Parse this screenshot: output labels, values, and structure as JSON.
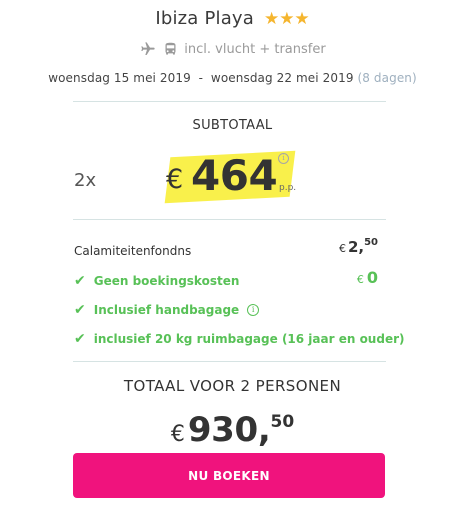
{
  "hotel": {
    "name": "Ibiza Playa",
    "stars": "★★★",
    "star_count": 3
  },
  "includes": {
    "text": "incl. vlucht + transfer",
    "icons": [
      "plane-icon",
      "bus-icon"
    ]
  },
  "dates": {
    "range": "woensdag 15 mei 2019  -  woensdag 22 mei 2019",
    "duration": "(8 dagen)"
  },
  "subtotal": {
    "label": "SUBTOTAAL",
    "quantity": "2x",
    "currency": "€",
    "amount": "464",
    "per_person": "p.p.",
    "info_symbol": "i"
  },
  "fees": {
    "fund_label": "Calamiteitenfondns",
    "fund_currency": "€",
    "fund_whole": "2,",
    "fund_cents": "50"
  },
  "features": [
    {
      "label": "Geen boekingskosten",
      "icon": "check-icon",
      "amount_currency": "€",
      "amount": "0"
    },
    {
      "label": "Inclusief handbagage",
      "icon": "check-icon",
      "info_symbol": "i"
    },
    {
      "label": "inclusief 20 kg ruimbagage (16 jaar en ouder)",
      "icon": "check-icon"
    }
  ],
  "total": {
    "label": "TOTAAL VOOR 2 PERSONEN",
    "currency": "€",
    "amount_whole": "930,",
    "amount_cents": "50"
  },
  "cta": {
    "label": "NU BOEKEN"
  },
  "colors": {
    "accent": "#f0137d",
    "success": "#58c157",
    "star": "#f5b52e",
    "highlight": "#f8ef3c",
    "divider": "#d6e3e3",
    "muted": "#9a9a9a"
  }
}
